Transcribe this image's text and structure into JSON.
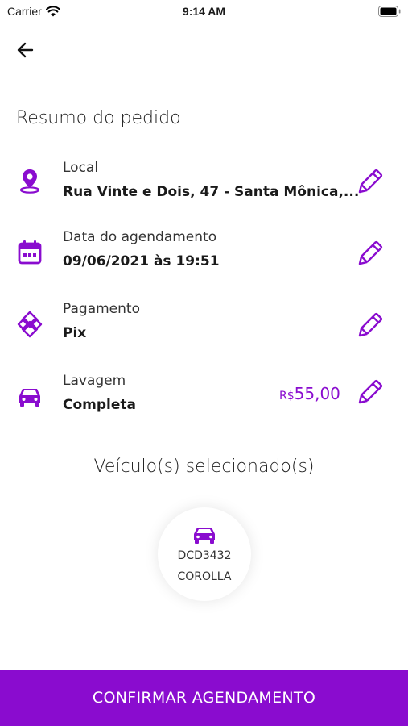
{
  "status_bar": {
    "carrier": "Carrier",
    "time": "9:14 AM"
  },
  "page": {
    "title": "Resumo do pedido"
  },
  "colors": {
    "accent": "#8a0ccf"
  },
  "summary": {
    "local": {
      "icon": "location-pin-icon",
      "label": "Local",
      "value": "Rua Vinte e Dois, 47 - Santa Mônica,..."
    },
    "date": {
      "icon": "calendar-icon",
      "label": "Data do agendamento",
      "value": "09/06/2021 às 19:51"
    },
    "payment": {
      "icon": "pix-icon",
      "label": "Pagamento",
      "value": "Pix"
    },
    "wash": {
      "icon": "car-icon",
      "label": "Lavagem",
      "value": "Completa",
      "price_currency": "R$",
      "price_amount": "55,00"
    }
  },
  "vehicles": {
    "title": "Veículo(s) selecionado(s)",
    "items": [
      {
        "plate": "DCD3432",
        "model": "COROLLA"
      }
    ]
  },
  "confirm_button": {
    "label": "CONFIRMAR AGENDAMENTO"
  }
}
